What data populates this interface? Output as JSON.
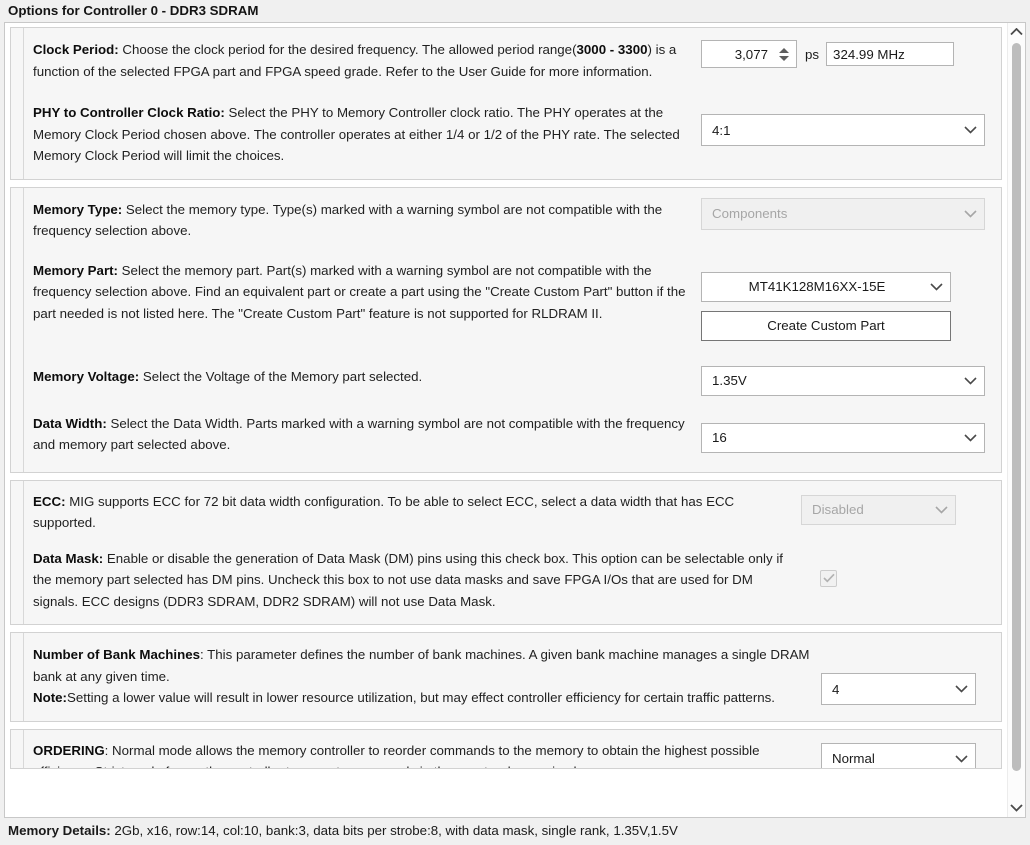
{
  "window": {
    "title": "Options for Controller 0 - DDR3 SDRAM"
  },
  "sections": [
    {
      "id": "clock-group",
      "rows": [
        {
          "id": "clock-period",
          "label": "Clock Period:",
          "description": " Choose the clock period for the desired frequency. The allowed period range(",
          "description_bold2": "3000 - 3300",
          "description_tail": ") is a function of the selected FPGA part and FPGA speed grade. Refer to the User Guide for more information.",
          "value": "3,077",
          "unit": "ps",
          "frequency": "324.99 MHz"
        },
        {
          "id": "phy-ratio",
          "label": "PHY to Controller Clock Ratio:",
          "description": " Select the PHY to Memory Controller clock ratio. The PHY operates at the Memory Clock Period chosen above. The controller operates at either 1/4 or 1/2 of the PHY rate. The selected Memory Clock Period will limit the choices.",
          "value": "4:1"
        }
      ]
    },
    {
      "id": "memory-group",
      "rows": [
        {
          "id": "memory-type",
          "label": "Memory Type:",
          "description": " Select the memory type. Type(s) marked with a warning symbol are not compatible with the frequency selection above.",
          "value": "Components",
          "disabled": true
        },
        {
          "id": "memory-part",
          "label": "Memory Part:",
          "description": " Select the memory part. Part(s) marked with a warning symbol are not compatible with the frequency selection above. Find an equivalent part or create a part using the \"Create Custom Part\" button if the part needed is not listed here. The \"Create Custom Part\" feature is not supported for RLDRAM II.",
          "value": "MT41K128M16XX-15E",
          "button_label": "Create Custom Part"
        },
        {
          "id": "memory-voltage",
          "label": "Memory Voltage:",
          "description": " Select the Voltage of the Memory part selected.",
          "value": "1.35V"
        },
        {
          "id": "data-width",
          "label": "Data Width:",
          "description": " Select the Data Width. Parts marked with a warning symbol are not compatible with the frequency and memory part selected above.",
          "value": "16"
        }
      ]
    },
    {
      "id": "ecc-group",
      "rows": [
        {
          "id": "ecc",
          "label": "ECC:",
          "description": " MIG supports ECC for 72 bit data width configuration. To be able to select ECC, select a data width that has ECC supported.",
          "value": "Disabled",
          "disabled": true
        },
        {
          "id": "data-mask",
          "label": "Data Mask:",
          "description": " Enable or disable the generation of Data Mask (DM) pins using this check box. This option can be selectable only if the memory part selected has DM pins. Uncheck this box to not use data masks and save FPGA I/Os that are used for DM signals. ECC designs (DDR3 SDRAM, DDR2 SDRAM) will not use Data Mask.",
          "checked": true
        }
      ]
    },
    {
      "id": "bank-machines-group",
      "rows": [
        {
          "id": "number-of-bank-machines",
          "label": "Number of Bank Machines",
          "description": ": This parameter defines the number of bank machines. A given bank machine manages a single DRAM bank at any given time.",
          "note_label": "Note:",
          "note_text": "Setting a lower value will result in lower resource utilization, but may effect controller efficiency for certain traffic patterns.",
          "value": "4"
        }
      ]
    },
    {
      "id": "ordering-group",
      "rows": [
        {
          "id": "ordering",
          "label": "ORDERING",
          "description": ": Normal mode allows the memory controller to reorder commands to the memory to obtain the highest possible efficiency. Strict mode forces the controller to execute commands in the exact order received.",
          "value": "Normal"
        }
      ]
    }
  ],
  "scrollbar": {
    "up_arrow": "chevron-up",
    "down_arrow": "chevron-down"
  },
  "footer": {
    "label": "Memory Details:",
    "text": " 2Gb, x16, row:14, col:10, bank:3, data bits per strobe:8, with data mask, single rank, 1.35V,1.5V"
  }
}
